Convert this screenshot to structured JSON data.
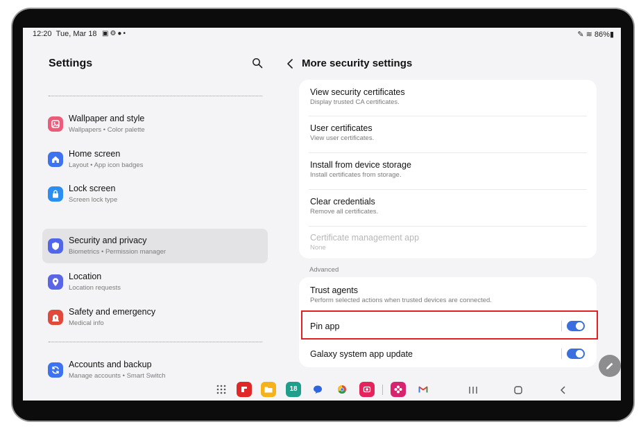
{
  "status_bar": {
    "time": "12:20",
    "date": "Tue, Mar 18",
    "notification_icons": [
      "image-icon",
      "settings-icon",
      "bulb-icon",
      "dot-icon"
    ],
    "battery": "86%"
  },
  "left_panel": {
    "title": "Settings",
    "items": [
      {
        "label": "Wallpaper and style",
        "sub": "Wallpapers  •  Color palette",
        "icon": "wallpaper-icon",
        "color": "#ea5c7a"
      },
      {
        "label": "Home screen",
        "sub": "Layout  •  App icon badges",
        "icon": "home-icon",
        "color": "#3d72f0"
      },
      {
        "label": "Lock screen",
        "sub": "Screen lock type",
        "icon": "lock-icon",
        "color": "#2a8ff0"
      },
      {
        "label": "Security and privacy",
        "sub": "Biometrics  •  Permission manager",
        "icon": "shield-icon",
        "color": "#5166e8",
        "selected": true
      },
      {
        "label": "Location",
        "sub": "Location requests",
        "icon": "location-icon",
        "color": "#5a66e6"
      },
      {
        "label": "Safety and emergency",
        "sub": "Medical info",
        "icon": "emergency-icon",
        "color": "#e04a3c"
      },
      {
        "label": "Accounts and backup",
        "sub": "Manage accounts  •  Smart Switch",
        "icon": "sync-icon",
        "color": "#3d72f0"
      }
    ]
  },
  "right_panel": {
    "title": "More security settings",
    "certificates": [
      {
        "label": "View security certificates",
        "sub": "Display trusted CA certificates."
      },
      {
        "label": "User certificates",
        "sub": "View user certificates."
      },
      {
        "label": "Install from device storage",
        "sub": "Install certificates from storage."
      },
      {
        "label": "Clear credentials",
        "sub": "Remove all certificates."
      },
      {
        "label": "Certificate management app",
        "sub": "None",
        "disabled": true
      }
    ],
    "section_advanced": "Advanced",
    "advanced": [
      {
        "label": "Trust agents",
        "sub": "Perform selected actions when trusted devices are connected."
      },
      {
        "label": "Pin app",
        "toggle": true,
        "on": true
      },
      {
        "label": "Galaxy system app update",
        "toggle": true,
        "on": true
      }
    ]
  },
  "taskbar": {
    "apps": [
      "app-drawer-icon",
      "flipboard-icon",
      "files-icon",
      "calendar-icon",
      "messages-icon",
      "chrome-icon",
      "screen-recorder-icon",
      "bixby-icon",
      "gmail-icon"
    ],
    "calendar_day": "18",
    "nav": [
      "recents-icon",
      "home-icon",
      "back-icon"
    ]
  },
  "colors": {
    "accent": "#3b6fe0",
    "highlight": "#e02020"
  }
}
